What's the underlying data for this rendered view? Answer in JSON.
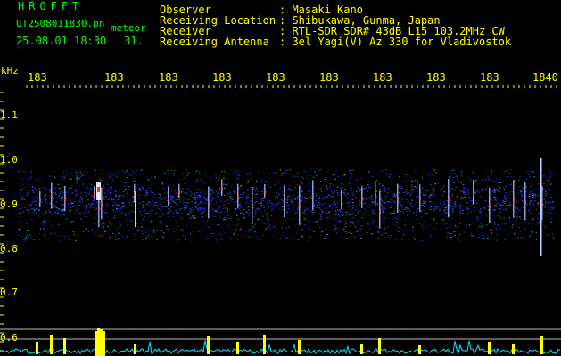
{
  "header": {
    "app_title": "HROFFT",
    "filename": "UT2508011830.pn",
    "meteor_label": "meteor",
    "date_time": "25.08.01 18:30",
    "count": "31."
  },
  "meta": [
    {
      "label": "Observer",
      "value": ": Masaki Kano"
    },
    {
      "label": "Receiving Location",
      "value": ": Shibukawa, Gunma, Japan"
    },
    {
      "label": "Receiver",
      "value": ": RTL-SDR SDR# 43dB L15 103.2MHz CW"
    },
    {
      "label": "Receiving Antenna",
      "value": ": 3el Yagi(V) Az 330 for Vladivostok"
    }
  ],
  "axes": {
    "freq_unit": "kHz",
    "freq_ticks": [
      "1.1",
      "1.0",
      "0.9",
      "0.8",
      "0.7",
      "0.6"
    ],
    "time_ticks": [
      "183",
      "183",
      "183",
      "183",
      "183",
      "183",
      "183",
      "183",
      "183",
      "1840"
    ]
  },
  "colors": {
    "header_text": "#00ff00",
    "meta_text": "#ffff00",
    "band_color": "#1f2fc8",
    "signal_yellow": "#ffff00",
    "noise_cyan": "#00e5ff"
  }
}
